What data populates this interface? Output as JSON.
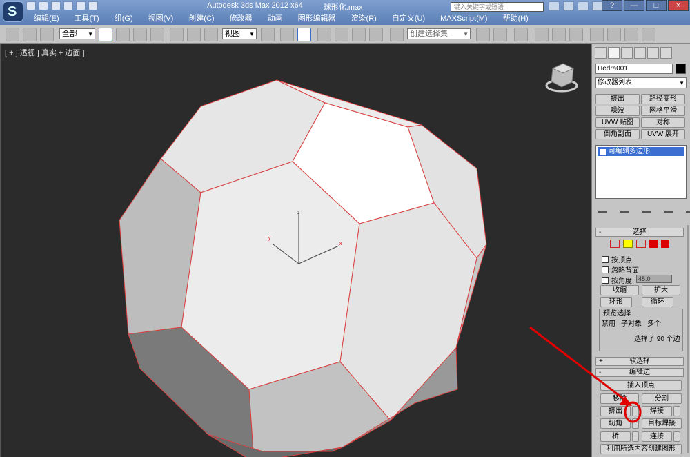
{
  "window": {
    "app_title": "Autodesk 3ds Max  2012 x64",
    "file_name": "球形化.max",
    "search_placeholder": "键入关键字或短语",
    "controls": [
      "—",
      "□",
      "×"
    ]
  },
  "menu": [
    "编辑(E)",
    "工具(T)",
    "组(G)",
    "视图(V)",
    "创建(C)",
    "修改器",
    "动画",
    "图形编辑器",
    "渲染(R)",
    "自定义(U)",
    "MAXScript(M)",
    "帮助(H)"
  ],
  "toolbar": {
    "selection_filter": "全部",
    "reference_coord": "视图",
    "named_selection": "创建选择集"
  },
  "viewport": {
    "label": "[ + ] 透视 ] 真实 + 边面 ]",
    "axis_labels": {
      "x": "x",
      "y": "y",
      "z": "z"
    }
  },
  "command_panel": {
    "object_name": "Hedra001",
    "modifier_list": "修改器列表",
    "modifier_buttons": [
      [
        "挤出",
        "路径变形"
      ],
      [
        "噪波",
        "网格平滑"
      ],
      [
        "UVW 贴图",
        "对称"
      ],
      [
        "倒角剖面",
        "UVW 展开"
      ]
    ],
    "stack_item": "可编辑多边形",
    "selection": {
      "title": "选择",
      "by_vertex": "按顶点",
      "ignore_backfacing": "忽略背面",
      "by_angle": "按角度:",
      "angle_value": "45.0",
      "shrink": "收缩",
      "grow": "扩大",
      "ring": "环形",
      "loop": "循环",
      "preview_title": "预览选择",
      "preview_options": [
        "禁用",
        "子对象",
        "多个"
      ],
      "status": "选择了 90 个边"
    },
    "soft_selection": "软选择",
    "edit_edges": {
      "title": "编辑边",
      "insert_vertex": "插入顶点",
      "remove": "移除",
      "split": "分割",
      "extrude": "挤出",
      "weld": "焊接",
      "chamfer": "切角",
      "target_weld": "目标焊接",
      "bridge": "桥",
      "connect": "连接",
      "create_shape": "利用所选内容创建图形"
    }
  },
  "colors": {
    "title_bar": "#6a8ac0",
    "viewport_bg": "#2b2b2b",
    "edge_selected": "#d84040",
    "annotation": "#e00000"
  }
}
